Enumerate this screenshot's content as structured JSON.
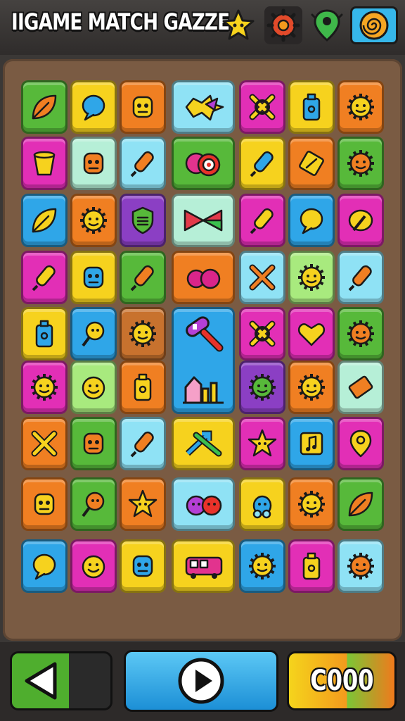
{
  "header": {
    "title": "IIGAME MATCH GAZZE",
    "icons": [
      "star-icon",
      "gear-icon",
      "map-pin-icon",
      "swirl-icon"
    ]
  },
  "colors": {
    "green": "#57b93a",
    "yellow": "#f6d21e",
    "orange": "#f07f22",
    "cyan": "#8fe2f5",
    "magenta": "#e22fb6",
    "blue": "#2fa6e8",
    "purple": "#8b3fc4",
    "lightgreen": "#a8ea7e",
    "brown": "#c8722e",
    "mint": "#b6efd7",
    "board": "#7a5b43"
  },
  "board": {
    "rows": [
      [
        [
          "green",
          "leaf-face-icon"
        ],
        [
          "yellow",
          "speech-bubble-icon"
        ],
        [
          "orange",
          "monster-icon"
        ],
        [
          "cyan",
          "splat-icon",
          2
        ],
        [
          "magenta",
          "x-ring-icon"
        ],
        [
          "yellow",
          "battery-icon"
        ],
        [
          "orange",
          "sun-burst-icon"
        ]
      ],
      [
        [
          "magenta",
          "cup-icon"
        ],
        [
          "mint",
          "robot-face-icon"
        ],
        [
          "cyan",
          "popsicle-icon"
        ],
        [
          "green",
          "target-icon",
          2
        ],
        [
          "yellow",
          "pencil-icon"
        ],
        [
          "orange",
          "card-icon"
        ],
        [
          "green",
          "smile-gear-icon"
        ]
      ],
      [
        [
          "blue",
          "leaf-icon"
        ],
        [
          "orange",
          "sun-icon"
        ],
        [
          "purple",
          "shield-icon"
        ],
        [
          "mint",
          "bowtie-icon",
          2
        ],
        [
          "magenta",
          "pencil-icon"
        ],
        [
          "blue",
          "balloon-icon"
        ],
        [
          "magenta",
          "paint-icon"
        ]
      ],
      [
        [
          "magenta",
          "pencil-icon"
        ],
        [
          "yellow",
          "robot-icon"
        ],
        [
          "green",
          "popsicle-icon"
        ],
        [
          "orange",
          "blob-icon",
          2
        ],
        [
          "cyan",
          "x-cross-icon"
        ],
        [
          "lightgreen",
          "gear-icon"
        ],
        [
          "cyan",
          "popsicle-icon"
        ]
      ],
      [
        [
          "yellow",
          "bag-icon"
        ],
        [
          "blue",
          "lollipop-icon"
        ],
        [
          "brown",
          "lion-icon"
        ],
        null,
        [
          "magenta",
          "x-ring-icon"
        ],
        [
          "magenta",
          "heart-box-icon"
        ],
        [
          "green",
          "smile-gear-icon"
        ]
      ],
      [
        [
          "magenta",
          "sun-icon"
        ],
        [
          "lightgreen",
          "cookie-icon"
        ],
        [
          "orange",
          "bottle-icon"
        ],
        null,
        [
          "purple",
          "face-gear-icon"
        ],
        [
          "orange",
          "sun-burst-icon"
        ],
        [
          "mint",
          "puzzle-icon"
        ]
      ],
      [
        [
          "orange",
          "x-cross-icon"
        ],
        [
          "green",
          "skull-icon"
        ],
        [
          "cyan",
          "popsicle-icon"
        ],
        [
          "yellow",
          "arrows-icon",
          2
        ],
        [
          "magenta",
          "star-icon"
        ],
        [
          "blue",
          "music-icon"
        ],
        [
          "magenta",
          "map-pin-icon"
        ]
      ],
      [
        [
          "orange",
          "monster-icon"
        ],
        [
          "green",
          "lollipop-icon"
        ],
        [
          "orange",
          "star-icon"
        ],
        [
          "cyan",
          "monster-pair-icon",
          2
        ],
        [
          "yellow",
          "acorn-icon"
        ],
        [
          "orange",
          "sun-icon"
        ],
        [
          "green",
          "leaf-icon"
        ]
      ],
      [
        [
          "blue",
          "chat-icon"
        ],
        [
          "magenta",
          "smile-icon"
        ],
        [
          "yellow",
          "robot-icon"
        ],
        [
          "yellow",
          "bus-icon",
          2
        ],
        [
          "blue",
          "gear-icon"
        ],
        [
          "magenta",
          "battery-icon"
        ],
        [
          "cyan",
          "smile-gear-icon"
        ]
      ]
    ],
    "big_tile": {
      "color": "blue",
      "icons": [
        "hammer-icon",
        "chart-icon"
      ]
    }
  },
  "controls": {
    "back_icon": "back-arrow-icon",
    "play_icon": "play-icon",
    "score": "C000"
  }
}
